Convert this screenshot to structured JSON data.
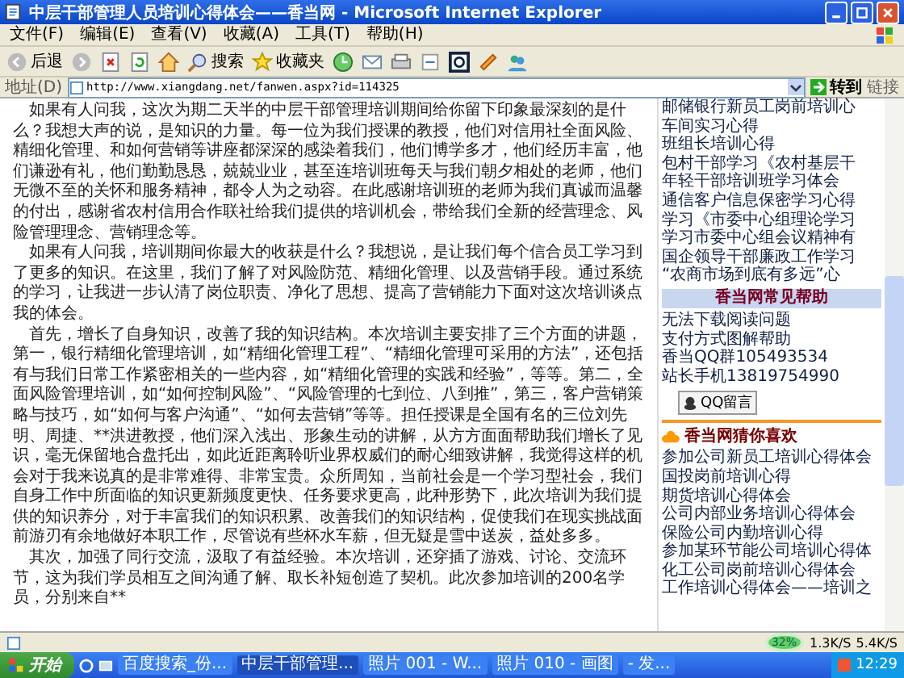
{
  "window": {
    "title": "中层干部管理人员培训心得体会——香当网 - Microsoft Internet Explorer"
  },
  "menu": [
    "文件(F)",
    "编辑(E)",
    "查看(V)",
    "收藏(A)",
    "工具(T)",
    "帮助(H)"
  ],
  "toolbar": {
    "back": "后退",
    "search": "搜索",
    "favorites": "收藏夹"
  },
  "address": {
    "label": "地址(D)",
    "value": "http://www.xiangdang.net/fanwen.aspx?id=114325",
    "go": "转到",
    "links": "链接"
  },
  "article": {
    "paragraphs": [
      "如果有人问我，这次为期二天半的中层干部管理培训期间给你留下印象最深刻的是什么？我想大声的说，是知识的力量。每一位为我们授课的教授，他们对信用社全面风险、精细化管理、和如何营销等讲座都深深的感染着我们，他们博学多才，他们经历丰富，他们谦逊有礼，他们勤勤恳恳，兢兢业业，甚至连培训班每天与我们朝夕相处的老师，他们无微不至的关怀和服务精神，都令人为之动容。在此感谢培训班的老师为我们真诚而温馨的付出，感谢省农村信用合作联社给我们提供的培训机会，带给我们全新的经营理念、风险管理理念、营销理念等。",
      "如果有人问我，培训期间你最大的收获是什么？我想说，是让我们每个信合员工学习到了更多的知识。在这里，我们了解了对风险防范、精细化管理、以及营销手段。通过系统的学习，让我进一步认清了岗位职责、净化了思想、提高了营销能力下面对这次培训谈点我的体会。",
      "首先，增长了自身知识，改善了我的知识结构。本次培训主要安排了三个方面的讲题，第一，银行精细化管理培训，如“精细化管理工程”、“精细化管理可采用的方法”，还包括有与我们日常工作紧密相关的一些内容，如“精细化管理的实践和经验”，等等。第二，全面风险管理培训，如“如何控制风险”、“风险管理的七到位、八到推”，第三，客户营销策略与技巧，如“如何与客户沟通”、“如何去营销”等等。担任授课是全国有名的三位刘先明、周捷、**洪进教授，他们深入浅出、形象生动的讲解，从方方面面帮助我们增长了见识，毫无保留地合盘托出，如此近距离聆听业界权威们的耐心细致讲解，我觉得这样的机会对于我来说真的是非常难得、非常宝贵。众所周知，当前社会是一个学习型社会，我们自身工作中所面临的知识更新频度更快、任务要求更高，此种形势下，此次培训为我们提供的知识养分，对于丰富我们的知识积累、改善我们的知识结构，促使我们在现实挑战面前游刃有余地做好本职工作，尽管说有些杯水车薪，但无疑是雪中送炭，益处多多。",
      "其次，加强了同行交流，汲取了有益经验。本次培训，还穿插了游戏、讨论、交流环节，这为我们学员相互之间沟通了解、取长补短创造了契机。此次参加培训的200名学员，分别来自**"
    ]
  },
  "sidebar": {
    "top_links": [
      "邮储银行新员工岗前培训心",
      "车间实习心得",
      "班组长培训心得",
      "包村干部学习《农村基层干",
      "年轻干部培训班学习体会",
      "通信客户信息保密学习心得",
      "学习《市委中心组理论学习",
      "学习市委中心组会议精神有",
      "国企领导干部廉政工作学习",
      "“农商市场到底有多远”心"
    ],
    "help": {
      "title": "香当网常见帮助",
      "items": [
        "无法下载阅读问题",
        "支付方式图解帮助",
        "香当QQ群105493534",
        "站长手机13819754990"
      ],
      "button": "QQ留言"
    },
    "recommend": {
      "title": "香当网猜你喜欢",
      "items": [
        "参加公司新员工培训心得体会",
        "国投岗前培训心得",
        "期货培训心得体会",
        "公司内部业务培训心得体会",
        "保险公司内勤培训心得",
        "参加某环节能公司培训心得体",
        "化工公司岗前培训心得体会",
        "工作培训心得体会——培训之"
      ]
    }
  },
  "status_bar": {
    "meter": "32%",
    "upload": "1.3K/S",
    "download": "5.4K/S"
  },
  "taskbar": {
    "start": "开始",
    "tasks": [
      {
        "label": "百度搜索_份...",
        "selected": false
      },
      {
        "label": "中层干部管理...",
        "selected": true
      },
      {
        "label": "照片 001 - W...",
        "selected": false
      },
      {
        "label": "照片 010 - 画图",
        "selected": false
      },
      {
        "label": "- 发...",
        "selected": false
      }
    ],
    "clock": "12:29"
  }
}
